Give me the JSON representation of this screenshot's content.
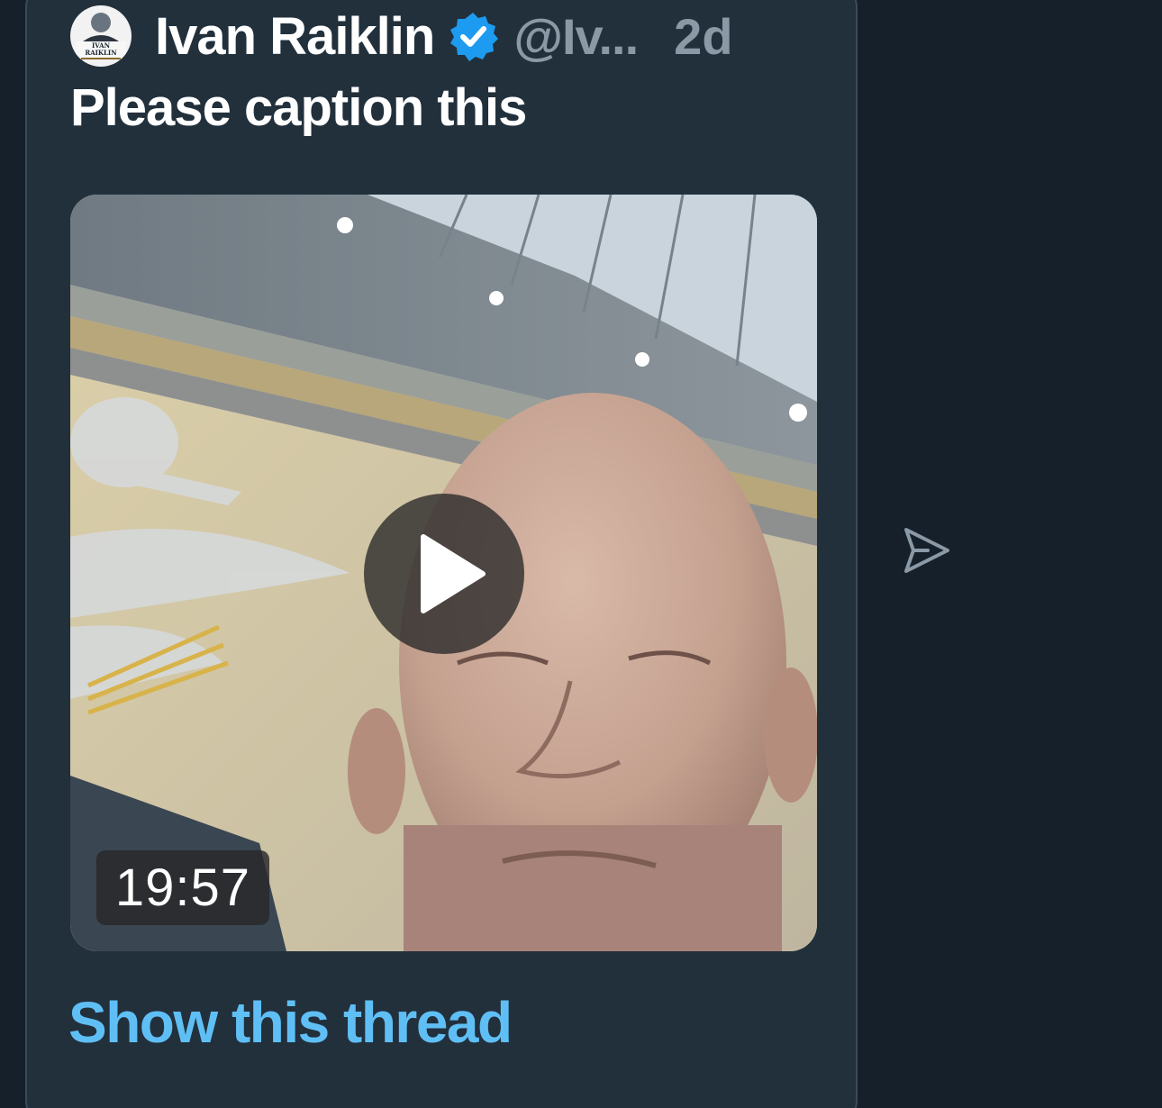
{
  "tweet": {
    "author_name": "Ivan Raiklin",
    "author_handle": "@Iv...",
    "timestamp": "2d",
    "text": "Please caption this",
    "verified": true,
    "avatar_text": [
      "IVAN",
      "RAIKLIN"
    ],
    "media": {
      "type": "video",
      "duration": "19:57"
    },
    "show_thread_label": "Show this thread"
  },
  "icons": {
    "verified": "verified-badge-icon",
    "play": "play-icon",
    "share": "send-icon"
  },
  "colors": {
    "background": "#15202b",
    "card": "#22303c",
    "card_border": "#3d4a57",
    "link": "#5fbff5",
    "muted": "#8b98a5",
    "verified": "#1d9bf0"
  }
}
